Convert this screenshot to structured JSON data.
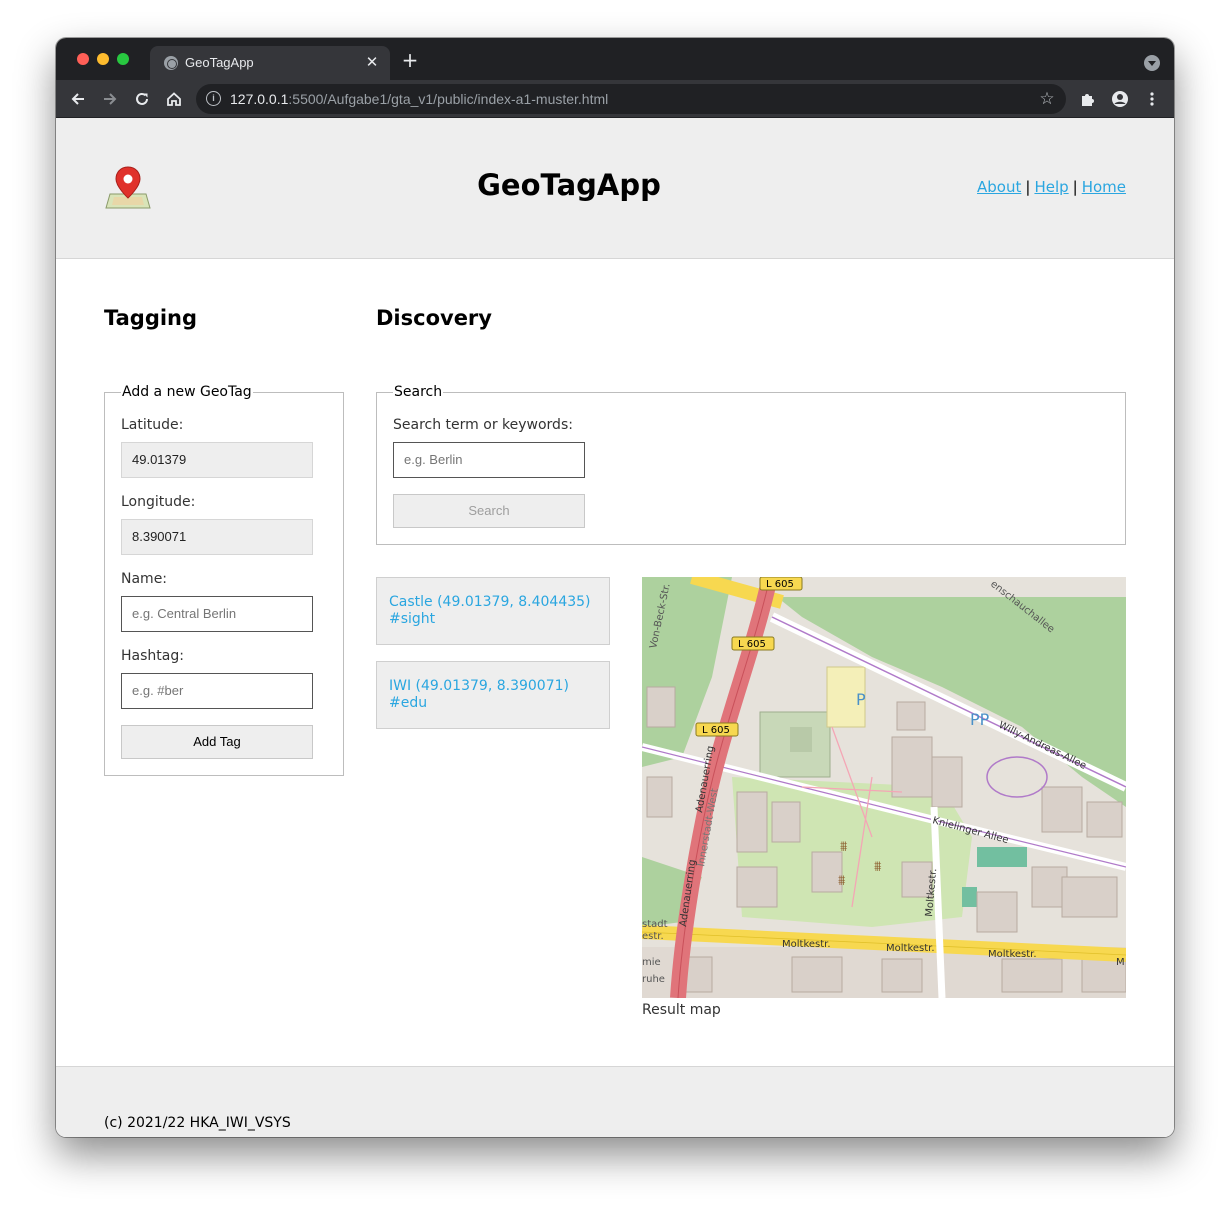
{
  "browser": {
    "tab_title": "GeoTagApp",
    "new_tab_symbol": "+",
    "url_host": "127.0.0.1",
    "url_rest": ":5500/Aufgabe1/gta_v1/public/index-a1-muster.html"
  },
  "header": {
    "title": "GeoTagApp",
    "nav": [
      {
        "label": "About"
      },
      {
        "label": "Help"
      },
      {
        "label": "Home"
      }
    ],
    "nav_separator": "|"
  },
  "tagging": {
    "heading": "Tagging",
    "legend": "Add a new GeoTag",
    "latitude_label": "Latitude:",
    "latitude_value": "49.01379",
    "longitude_label": "Longitude:",
    "longitude_value": "8.390071",
    "name_label": "Name:",
    "name_placeholder": "e.g. Central Berlin",
    "hashtag_label": "Hashtag:",
    "hashtag_placeholder": "e.g. #ber",
    "submit_label": "Add Tag"
  },
  "discovery": {
    "heading": "Discovery",
    "legend": "Search",
    "search_label": "Search term or keywords:",
    "search_placeholder": "e.g. Berlin",
    "search_button": "Search",
    "results": [
      {
        "line1": "Castle (49.01379, 8.404435)",
        "line2": "#sight"
      },
      {
        "line1": "IWI (49.01379, 8.390071)",
        "line2": "#edu"
      }
    ],
    "map_caption": "Result map",
    "map_labels": {
      "road_l605": "L 605",
      "von_beck": "Von-Beck-Str.",
      "adenauerring": "Adenauerring",
      "innerstadt_west": "Innerstadt-West",
      "willy_andreas": "Willy-Andreas-Allee",
      "kriegsschauchallee": "enschauchallee",
      "knielinger": "Knielinger Allee",
      "moltkestr": "Moltkestr.",
      "moltkestr_v": "Moltkestr.",
      "parking": "P",
      "parking_double": "PP",
      "edge_stadt": "stadt",
      "edge_estr": "estr.",
      "edge_mie": "mie",
      "edge_ruhe": "ruhe",
      "edge_m": "M"
    }
  },
  "footer": {
    "text": "(c) 2021/22 HKA_IWI_VSYS"
  },
  "colors": {
    "link": "#2aa6e0",
    "header_bg": "#eeeeee",
    "chrome_dark": "#202124",
    "chrome_toolbar": "#35363a"
  }
}
